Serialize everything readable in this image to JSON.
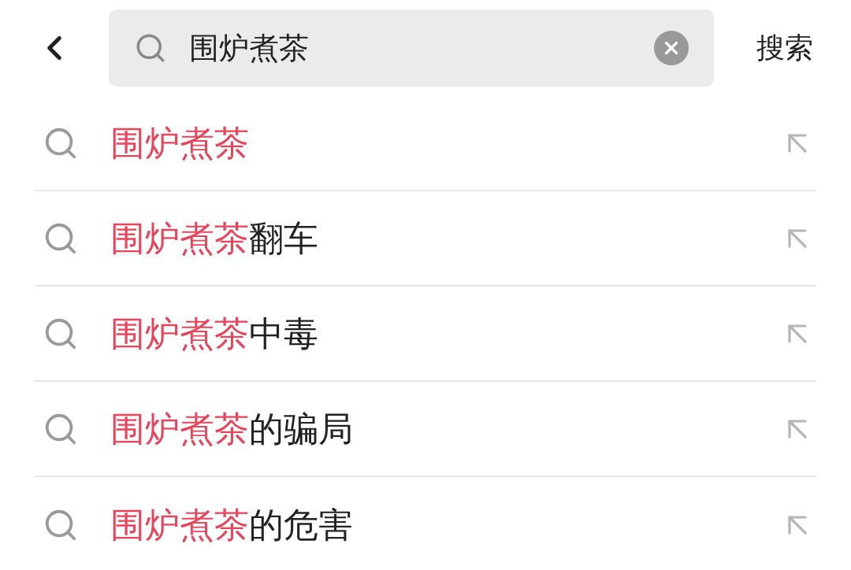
{
  "search": {
    "value": "围炉煮茶",
    "submit": "搜索"
  },
  "suggestions": [
    {
      "match": "围炉煮茶"
    },
    {
      "match": "围炉煮茶",
      "rest": "翻车"
    },
    {
      "match": "围炉煮茶",
      "rest": "中毒"
    },
    {
      "match": "围炉煮茶",
      "rest": "的骗局"
    },
    {
      "match": "围炉煮茶",
      "rest": "的危害"
    }
  ]
}
